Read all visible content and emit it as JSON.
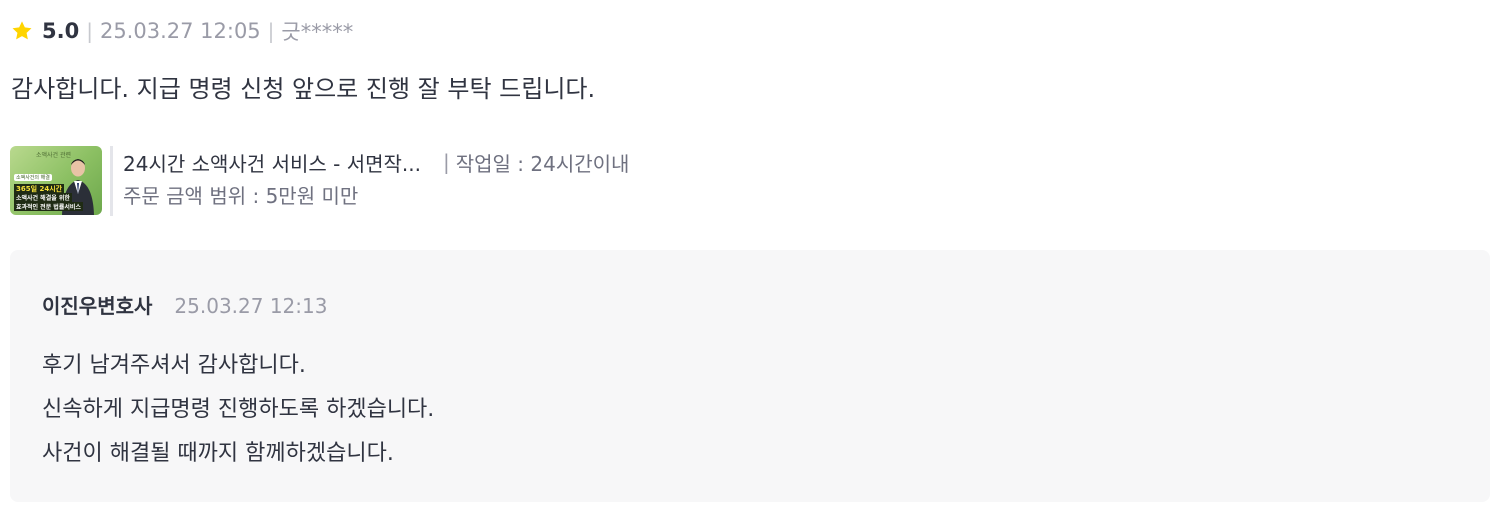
{
  "review": {
    "rating": "5.0",
    "date": "25.03.27 12:05",
    "reviewer": "긋*****",
    "text": "감사합니다. 지급 명령 신청 앞으로 진행 잘 부탁 드립니다.",
    "star_icon": "star-icon",
    "star_color": "#ffd400"
  },
  "product": {
    "title": "24시간 소액사건 서비스 - 서면작...",
    "work_label": "작업일 : 24시간이내",
    "price_range": "주문 금액 범위 : 5만원 미만",
    "thumbnail": {
      "top_text": "소액사건 관련",
      "badge": "소액사건의 해결",
      "highlight": "365일 24시간",
      "line1": "소액사건 해결을 위한",
      "line2": "효과적인 전문 법률서비스"
    }
  },
  "reply": {
    "author": "이진우변호사",
    "date": "25.03.27 12:13",
    "lines": [
      "후기 남겨주셔서 감사합니다.",
      "신속하게 지급명령 진행하도록 하겠습니다.",
      "사건이 해결될 때까지 함께하겠습니다."
    ]
  }
}
